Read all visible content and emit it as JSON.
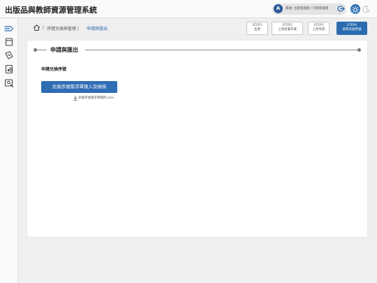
{
  "header": {
    "title": "出版品與教師資源管理系統",
    "user": {
      "initial": "A",
      "name": "帳號: 出版管理組 / 行銷管理組"
    }
  },
  "breadcrumb": {
    "items": [
      "序號兌換與管理 /",
      "申請與匯出"
    ]
  },
  "steps": [
    {
      "number": "STEP1",
      "label": "生產"
    },
    {
      "number": "STEP2",
      "label": "上架前置作業"
    },
    {
      "number": "STEP3",
      "label": "上架完成"
    },
    {
      "number": "STEP4",
      "label": "取得兌換序號"
    }
  ],
  "main": {
    "section_title": "申請與匯出",
    "field_label": "申請兌換序號",
    "import_button": "兌換序號需求單匯入及檢核",
    "download_link": "兌換序號需求單範例.xlsx"
  },
  "colors": {
    "accent": "#2b6cb0",
    "background": "#efefef",
    "surface": "#ffffff"
  }
}
